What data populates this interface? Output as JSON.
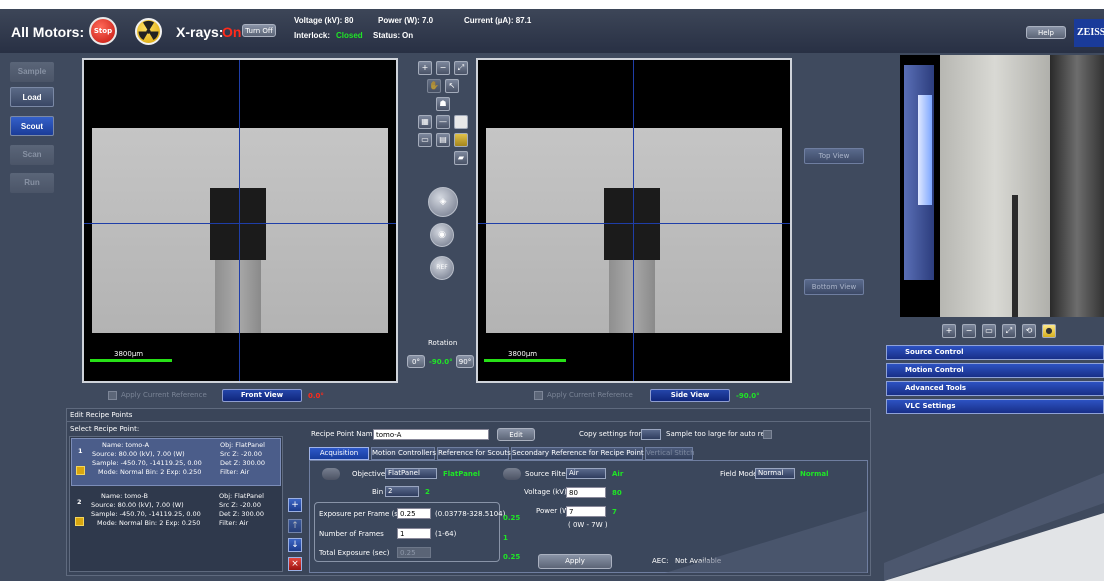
{
  "topbar": {
    "all_motors": "All Motors:",
    "stop_label": "Stop",
    "xrays_label": "X-rays:",
    "xrays_state": "On",
    "turn_off": "Turn Off",
    "voltage": "Voltage (kV):  80",
    "power": "Power (W):  7.0",
    "current": "Current (µA):  87.1",
    "interlock_label": "Interlock:",
    "interlock_value": "Closed",
    "status_label": "Status:",
    "status_value": "On",
    "help": "Help",
    "brand": "ZEISS"
  },
  "nav": {
    "sample": "Sample",
    "load": "Load",
    "scout": "Scout",
    "scan": "Scan",
    "run": "Run"
  },
  "views": {
    "front_scale": "3800µm",
    "side_scale": "3800µm",
    "rotation_label": "Rotation",
    "rot_0": "0°",
    "rot_value": "-90.0°",
    "rot_90": "90°",
    "top_view": "Top View",
    "bottom_view": "Bottom View",
    "apply_current_left": "Apply Current Reference",
    "apply_current_right": "Apply Current Reference",
    "front_view": "Front View",
    "front_angle": "0.0°",
    "side_view": "Side View",
    "side_angle": "-90.0°",
    "ref_label": "REF"
  },
  "recipe": {
    "title": "Edit Recipe Points",
    "select_title": "Select Recipe Point:",
    "points": [
      {
        "num": "1",
        "name": "Name: tomo-A",
        "obj": "Obj: FlatPanel",
        "source": "Source: 80.00 (kV), 7.00 (W)",
        "srcz": "Src Z: -20.00",
        "sample": "Sample: -450.70, -14119.25, 0.00",
        "detz": "Det Z: 300.00",
        "mode": "Mode: Normal     Bin: 2    Exp: 0.250",
        "filter": "Filter: Air"
      },
      {
        "num": "2",
        "name": "Name: tomo-B",
        "obj": "Obj: FlatPanel",
        "source": "Source: 80.00 (kV), 7.00 (W)",
        "srcz": "Src Z: -20.00",
        "sample": "Sample: -450.70, -14119.25, 0.00",
        "detz": "Det Z: 300.00",
        "mode": "Mode: Normal     Bin: 2    Exp: 0.250",
        "filter": "Filter: Air"
      }
    ],
    "point_name_label": "Recipe Point Name",
    "point_name_value": "tomo-A",
    "edit": "Edit",
    "copy_from": "Copy settings from:",
    "copy_value": "",
    "too_large": "Sample too large for auto refs",
    "tabs": [
      "Acquisition",
      "Motion Controllers",
      "Reference for Scouts",
      "Secondary Reference for Recipe Point",
      "Vertical Stitch"
    ],
    "objective_label": "Objective",
    "objective_value": "FlatPanel",
    "objective_status": "FlatPanel",
    "bin_label": "Bin",
    "bin_value": "2",
    "bin_status": "2",
    "source_filter_label": "Source Filter",
    "source_filter_value": "Air",
    "source_filter_status": "Air",
    "voltage_label": "Voltage (kV)",
    "voltage_value": "80",
    "voltage_status": "80",
    "power_label": "Power (W)",
    "power_value": "7",
    "power_status": "7",
    "power_range": "( 0W - 7W )",
    "field_mode_label": "Field Mode",
    "field_mode_value": "Normal",
    "field_mode_status": "Normal",
    "exposure_label": "Exposure per Frame (sec)",
    "exposure_value": "0.25",
    "exposure_range": "(0.03778-328.5104)",
    "exposure_status": "0.25",
    "frames_label": "Number of Frames",
    "frames_value": "1",
    "frames_range": "(1-64)",
    "frames_status": "1",
    "total_label": "Total Exposure (sec)",
    "total_value": "0.25",
    "total_status": "0.25",
    "apply": "Apply",
    "aec_label": "AEC:",
    "aec_value": "Not Available"
  },
  "right": {
    "panels": [
      "Source Control",
      "Motion Control",
      "Advanced Tools",
      "VLC Settings"
    ]
  }
}
